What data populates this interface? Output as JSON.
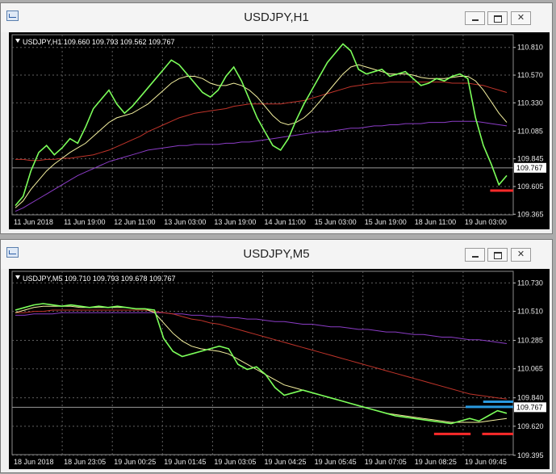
{
  "windows": [
    {
      "title": "USDJPY,H1",
      "controls": {
        "minimize": "minimize",
        "maximize": "maximize",
        "close": "✕"
      },
      "chart_info": "USDJPY,H1  109.660 109.793 109.562 109.767",
      "chart_data": {
        "type": "line",
        "series": [
          {
            "values": [
              109.44,
              109.52,
              109.74,
              109.9,
              109.96,
              109.88,
              109.94,
              110.02,
              109.98,
              110.12,
              110.28,
              110.36,
              110.44,
              110.32,
              110.24,
              110.3,
              110.38,
              110.46,
              110.54,
              110.62,
              110.7,
              110.66,
              110.58,
              110.5,
              110.42,
              110.38,
              110.44,
              110.56,
              110.64,
              110.52,
              110.36,
              110.2,
              110.08,
              109.96,
              109.92,
              110.02,
              110.18,
              110.32,
              110.44,
              110.56,
              110.68,
              110.76,
              110.84,
              110.78,
              110.62,
              110.58,
              110.6,
              110.62,
              110.56,
              110.58,
              110.6,
              110.54,
              110.48,
              110.5,
              110.54,
              110.52,
              110.56,
              110.58,
              110.54,
              110.2,
              109.96,
              109.8,
              109.62,
              109.7
            ]
          },
          {
            "values": [
              109.42,
              109.48,
              109.58,
              109.66,
              109.74,
              109.8,
              109.85,
              109.9,
              109.94,
              109.98,
              110.04,
              110.1,
              110.16,
              110.2,
              110.22,
              110.24,
              110.28,
              110.32,
              110.38,
              110.44,
              110.5,
              110.54,
              110.56,
              110.56,
              110.54,
              110.5,
              110.48,
              110.48,
              110.5,
              110.48,
              110.44,
              110.38,
              110.3,
              110.22,
              110.16,
              110.14,
              110.16,
              110.2,
              110.26,
              110.34,
              110.42,
              110.5,
              110.58,
              110.64,
              110.66,
              110.64,
              110.62,
              110.6,
              110.58,
              110.58,
              110.58,
              110.57,
              110.55,
              110.54,
              110.54,
              110.54,
              110.55,
              110.56,
              110.56,
              110.52,
              110.44,
              110.34,
              110.24,
              110.16
            ]
          },
          {
            "values": [
              109.84,
              109.84,
              109.83,
              109.83,
              109.84,
              109.84,
              109.85,
              109.85,
              109.86,
              109.87,
              109.88,
              109.9,
              109.92,
              109.95,
              109.98,
              110.01,
              110.04,
              110.08,
              110.11,
              110.14,
              110.17,
              110.2,
              110.22,
              110.24,
              110.25,
              110.26,
              110.27,
              110.28,
              110.3,
              110.31,
              110.32,
              110.32,
              110.32,
              110.32,
              110.32,
              110.33,
              110.34,
              110.35,
              110.37,
              110.39,
              110.41,
              110.43,
              110.45,
              110.47,
              110.48,
              110.49,
              110.5,
              110.5,
              110.51,
              110.51,
              110.51,
              110.51,
              110.51,
              110.51,
              110.51,
              110.51,
              110.5,
              110.5,
              110.5,
              110.49,
              110.48,
              110.46,
              110.44,
              110.42
            ]
          },
          {
            "values": [
              109.39,
              109.42,
              109.46,
              109.5,
              109.54,
              109.58,
              109.62,
              109.66,
              109.7,
              109.73,
              109.76,
              109.79,
              109.82,
              109.84,
              109.86,
              109.88,
              109.9,
              109.92,
              109.93,
              109.94,
              109.95,
              109.96,
              109.96,
              109.97,
              109.97,
              109.97,
              109.97,
              109.98,
              109.98,
              109.99,
              109.99,
              110.0,
              110.01,
              110.02,
              110.03,
              110.04,
              110.05,
              110.06,
              110.07,
              110.08,
              110.08,
              110.09,
              110.1,
              110.11,
              110.11,
              110.12,
              110.13,
              110.13,
              110.14,
              110.14,
              110.15,
              110.15,
              110.15,
              110.16,
              110.16,
              110.16,
              110.17,
              110.17,
              110.17,
              110.17,
              110.16,
              110.15,
              110.14,
              110.13
            ]
          }
        ],
        "ylim": [
          109.36,
          110.92
        ],
        "y_ticks": [
          "110.810",
          "110.570",
          "110.330",
          "110.085",
          "109.845",
          "109.605",
          "109.365"
        ],
        "x_ticks": [
          "11 Jun 2018",
          "11 Jun 19:00",
          "12 Jun 11:00",
          "13 Jun 03:00",
          "13 Jun 19:00",
          "14 Jun 11:00",
          "15 Jun 03:00",
          "15 Jun 19:00",
          "18 Jun 11:00",
          "19 Jun 03:00"
        ],
        "current_price": "109.767",
        "current_value": 109.767,
        "marker_lines": [
          {
            "color": "#ff2a2a",
            "y": 109.57,
            "from": 0.954,
            "to": 1.0
          }
        ],
        "colors": {
          "candles": "#7cff5a",
          "ma_fast": "#f6f2a0",
          "ma_mid": "#c0342a",
          "ma_slow": "#8b3cc6"
        }
      }
    },
    {
      "title": "USDJPY,M5",
      "controls": {
        "minimize": "minimize",
        "maximize": "maximize",
        "close": "✕"
      },
      "chart_info": "USDJPY,M5  109.710 109.793 109.678 109.767",
      "chart_data": {
        "type": "line",
        "series": [
          {
            "values": [
              110.52,
              110.54,
              110.56,
              110.57,
              110.56,
              110.55,
              110.56,
              110.55,
              110.54,
              110.55,
              110.54,
              110.55,
              110.54,
              110.53,
              110.53,
              110.52,
              110.3,
              110.2,
              110.16,
              110.18,
              110.2,
              110.22,
              110.24,
              110.22,
              110.1,
              110.06,
              110.08,
              110.02,
              109.92,
              109.86,
              109.88,
              109.9,
              109.88,
              109.86,
              109.84,
              109.82,
              109.8,
              109.78,
              109.76,
              109.74,
              109.72,
              109.7,
              109.69,
              109.68,
              109.67,
              109.66,
              109.65,
              109.64,
              109.66,
              109.68,
              109.66,
              109.7,
              109.74,
              109.72
            ]
          },
          {
            "values": [
              110.5,
              110.52,
              110.54,
              110.55,
              110.55,
              110.55,
              110.55,
              110.54,
              110.54,
              110.54,
              110.54,
              110.54,
              110.54,
              110.53,
              110.53,
              110.5,
              110.42,
              110.34,
              110.28,
              110.24,
              110.22,
              110.21,
              110.2,
              110.18,
              110.14,
              110.1,
              110.06,
              110.02,
              109.98,
              109.94,
              109.92,
              109.9,
              109.88,
              109.86,
              109.84,
              109.82,
              109.8,
              109.78,
              109.76,
              109.74,
              109.72,
              109.71,
              109.7,
              109.69,
              109.68,
              109.67,
              109.66,
              109.65,
              109.65,
              109.65,
              109.65,
              109.66,
              109.67,
              109.68
            ]
          },
          {
            "values": [
              110.5,
              110.5,
              110.51,
              110.51,
              110.52,
              110.52,
              110.52,
              110.52,
              110.52,
              110.52,
              110.52,
              110.52,
              110.52,
              110.52,
              110.52,
              110.51,
              110.5,
              110.49,
              110.47,
              110.45,
              110.44,
              110.42,
              110.41,
              110.39,
              110.37,
              110.35,
              110.33,
              110.31,
              110.29,
              110.27,
              110.25,
              110.23,
              110.21,
              110.19,
              110.17,
              110.15,
              110.13,
              110.11,
              110.09,
              110.07,
              110.05,
              110.03,
              110.01,
              109.99,
              109.97,
              109.95,
              109.93,
              109.91,
              109.89,
              109.87,
              109.86,
              109.85,
              109.84,
              109.83
            ]
          },
          {
            "values": [
              110.48,
              110.48,
              110.49,
              110.49,
              110.49,
              110.5,
              110.5,
              110.5,
              110.5,
              110.5,
              110.5,
              110.5,
              110.5,
              110.5,
              110.5,
              110.5,
              110.5,
              110.49,
              110.49,
              110.48,
              110.48,
              110.47,
              110.47,
              110.46,
              110.46,
              110.45,
              110.45,
              110.44,
              110.43,
              110.43,
              110.42,
              110.41,
              110.41,
              110.4,
              110.39,
              110.39,
              110.38,
              110.37,
              110.37,
              110.36,
              110.35,
              110.35,
              110.34,
              110.33,
              110.33,
              110.32,
              110.31,
              110.31,
              110.3,
              110.29,
              110.29,
              110.28,
              110.27,
              110.26
            ]
          }
        ],
        "ylim": [
          109.4,
          110.82
        ],
        "y_ticks": [
          "110.730",
          "110.510",
          "110.285",
          "110.065",
          "109.840",
          "109.620",
          "109.395"
        ],
        "x_ticks": [
          "18 Jun 2018",
          "18 Jun 23:05",
          "19 Jun 00:25",
          "19 Jun 01:45",
          "19 Jun 03:05",
          "19 Jun 04:25",
          "19 Jun 05:45",
          "19 Jun 07:05",
          "19 Jun 08:25",
          "19 Jun 09:45"
        ],
        "current_price": "109.767",
        "current_value": 109.767,
        "marker_lines": [
          {
            "color": "#ff2a2a",
            "y": 109.56,
            "from": 0.842,
            "to": 0.915
          },
          {
            "color": "#ff2a2a",
            "y": 109.56,
            "from": 0.938,
            "to": 1.0
          },
          {
            "color": "#2a9adf",
            "y": 109.77,
            "from": 0.905,
            "to": 1.0
          },
          {
            "color": "#2a9adf",
            "y": 109.81,
            "from": 0.94,
            "to": 1.0
          }
        ],
        "colors": {
          "candles": "#7cff5a",
          "ma_fast": "#f6f2a0",
          "ma_mid": "#c0342a",
          "ma_slow": "#8b3cc6"
        }
      }
    }
  ]
}
